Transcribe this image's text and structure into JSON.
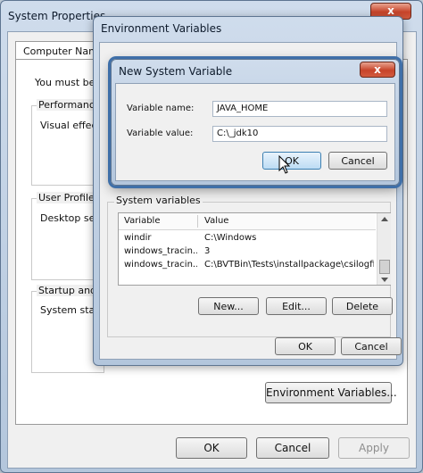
{
  "system_properties": {
    "title": "System Properties",
    "tab": "Computer Name",
    "admin_note": "You must be",
    "performance_label": "Performance",
    "performance_text": "Visual effect",
    "user_profiles_label": "User Profiles",
    "user_profiles_text": "Desktop set",
    "startup_label": "Startup and",
    "startup_text": "System start",
    "env_button": "Environment Variables...",
    "ok": "OK",
    "cancel": "Cancel",
    "apply": "Apply"
  },
  "environment_variables": {
    "title": "Environment Variables",
    "system_variables_label": "System variables",
    "columns": [
      "Variable",
      "Value"
    ],
    "rows": [
      {
        "variable": "windir",
        "value": "C:\\Windows"
      },
      {
        "variable": "windows_tracin...",
        "value": "3"
      },
      {
        "variable": "windows_tracin...",
        "value": "C:\\BVTBin\\Tests\\installpackage\\csilogfile..."
      }
    ],
    "new_button": "New...",
    "edit_button": "Edit...",
    "delete_button": "Delete",
    "ok": "OK",
    "cancel": "Cancel"
  },
  "new_system_variable": {
    "title": "New System Variable",
    "name_label": "Variable name:",
    "name_value": "JAVA_HOME",
    "value_label": "Variable value:",
    "value_value": "C:\\_jdk10",
    "ok": "OK",
    "cancel": "Cancel",
    "close_glyph": "x"
  },
  "colors": {
    "accent": "#3c7fb1",
    "close": "#c7442a"
  }
}
